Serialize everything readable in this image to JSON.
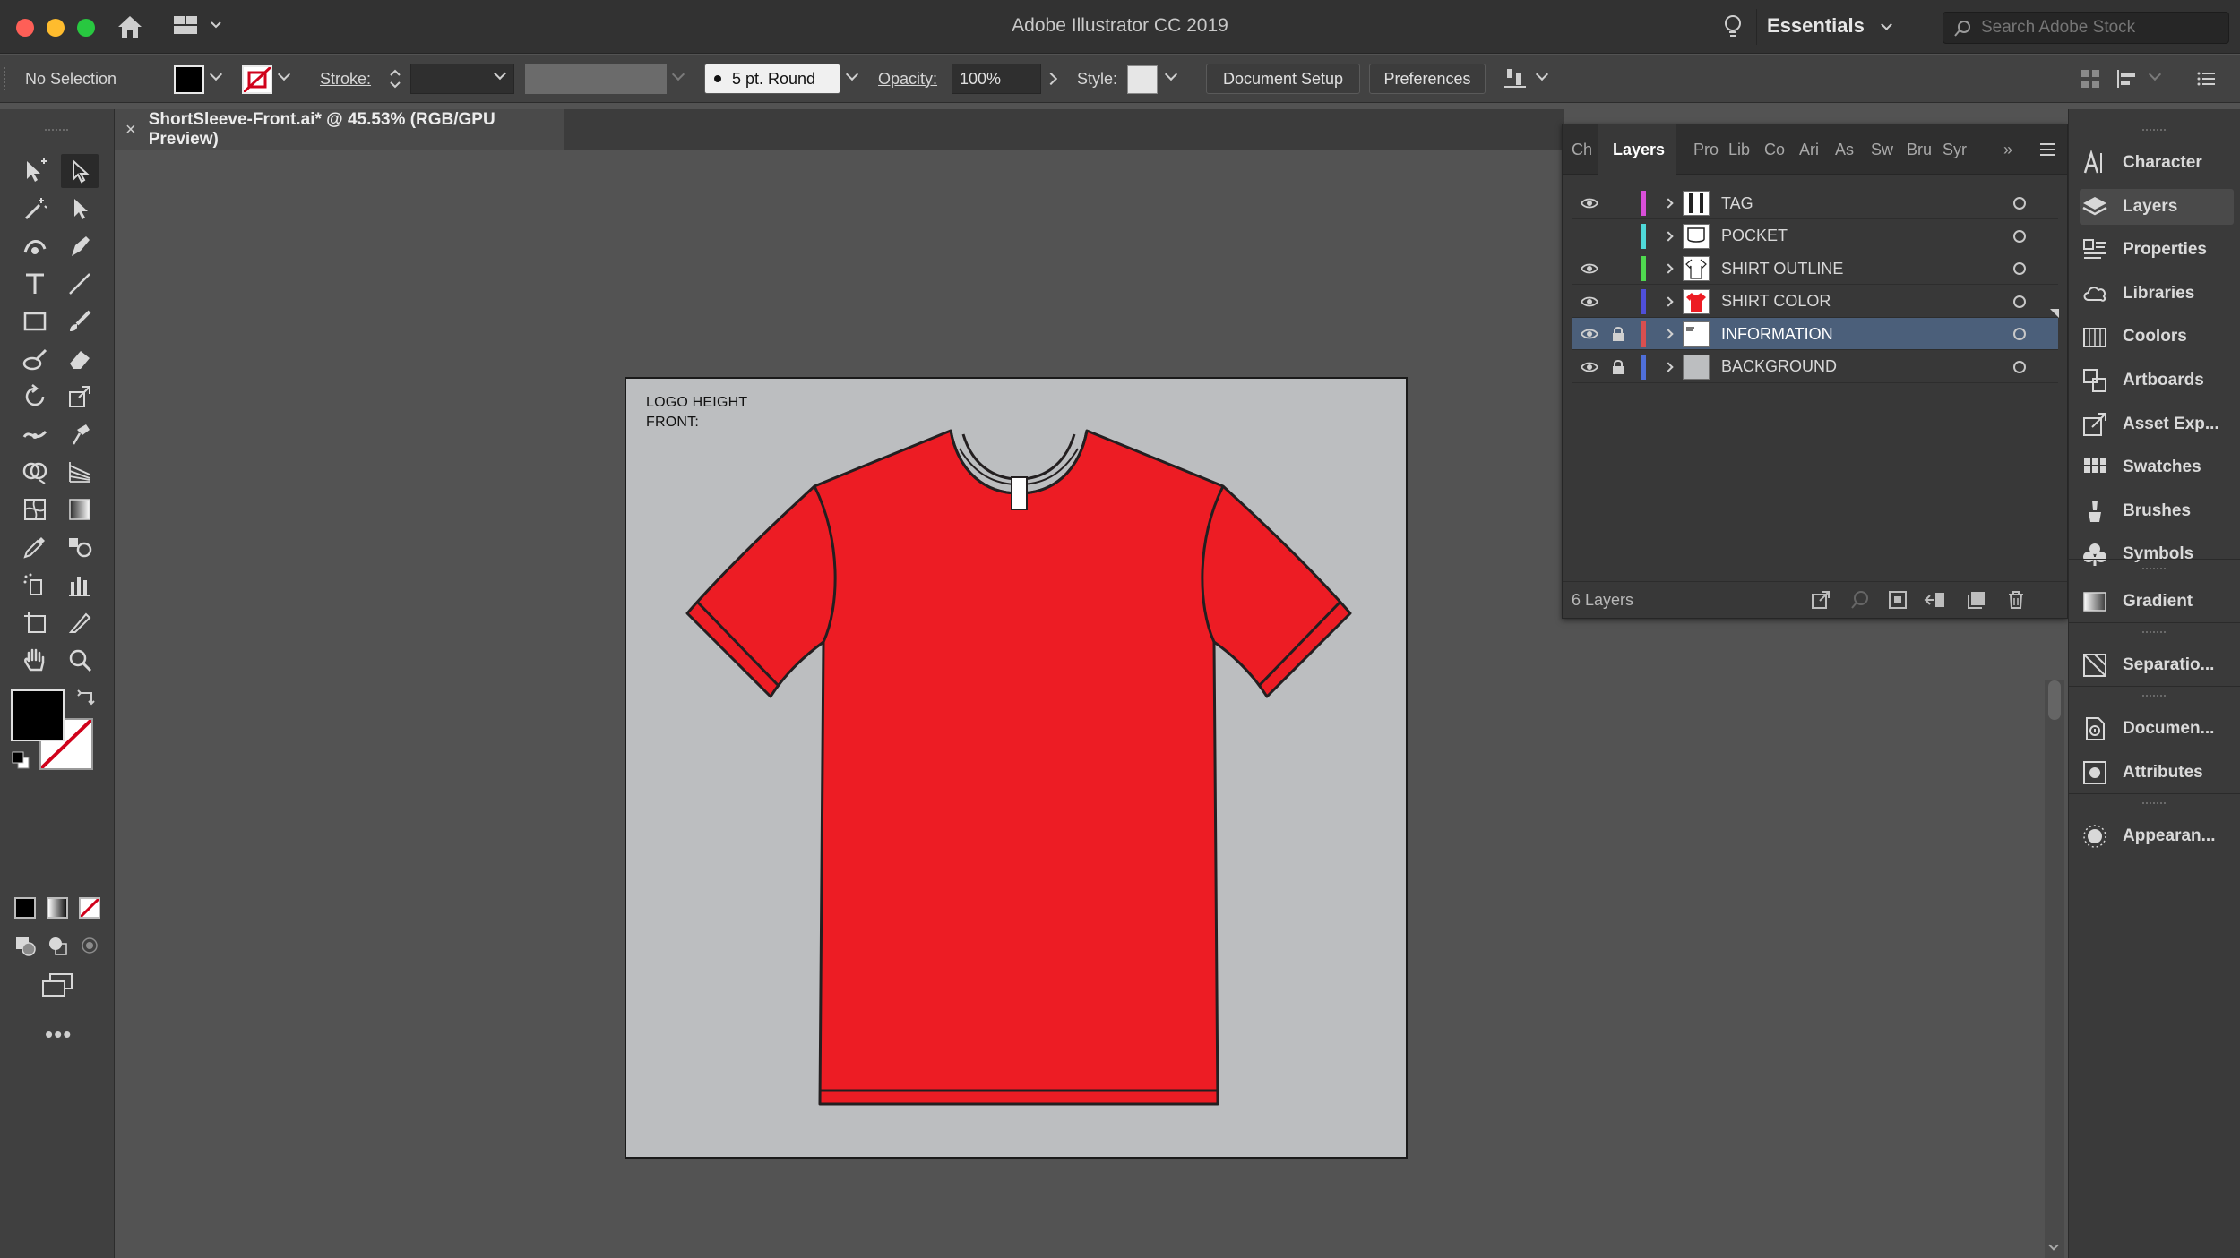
{
  "app": {
    "title": "Adobe Illustrator CC 2019",
    "workspace": "Essentials",
    "search_placeholder": "Search Adobe Stock"
  },
  "control_bar": {
    "selection": "No Selection",
    "stroke_label": "Stroke:",
    "brush": "5 pt. Round",
    "opacity_label": "Opacity:",
    "opacity_value": "100%",
    "style_label": "Style:",
    "document_setup": "Document Setup",
    "preferences": "Preferences"
  },
  "document_tab": {
    "title": "ShortSleeve-Front.ai* @ 45.53% (RGB/GPU Preview)"
  },
  "artboard": {
    "line1": "LOGO HEIGHT",
    "line2": "FRONT:"
  },
  "layers_panel": {
    "tabs": [
      "Ch",
      "Layers",
      "Pro",
      "Lib",
      "Co",
      "Ari",
      "As",
      "Sw",
      "Bru",
      "Syr"
    ],
    "layers": [
      {
        "name": "TAG",
        "color": "#d94fd9",
        "visible": true,
        "locked": false,
        "selected": false
      },
      {
        "name": "POCKET",
        "color": "#4fd9d9",
        "visible": false,
        "locked": false,
        "selected": false
      },
      {
        "name": "SHIRT OUTLINE",
        "color": "#4fd94f",
        "visible": true,
        "locked": false,
        "selected": false
      },
      {
        "name": "SHIRT COLOR",
        "color": "#4f4fd9",
        "visible": true,
        "locked": false,
        "selected": false
      },
      {
        "name": "INFORMATION",
        "color": "#d94f4f",
        "visible": true,
        "locked": true,
        "selected": true
      },
      {
        "name": "BACKGROUND",
        "color": "#4f6fd9",
        "visible": true,
        "locked": true,
        "selected": false
      }
    ],
    "count_text": "6 Layers"
  },
  "right_dock": {
    "group1": [
      "Character",
      "Layers",
      "Properties",
      "Libraries",
      "Coolors",
      "Artboards",
      "Asset Exp...",
      "Swatches",
      "Brushes",
      "Symbols"
    ],
    "group2": [
      "Gradient"
    ],
    "group3": [
      "Separatio..."
    ],
    "group4": [
      "Documen...",
      "Attributes"
    ],
    "group5": [
      "Appearan..."
    ]
  },
  "colors": {
    "shirt": "#ed1c24",
    "artboard": "#bcbec0",
    "selection_row": "#4b5f7a"
  }
}
